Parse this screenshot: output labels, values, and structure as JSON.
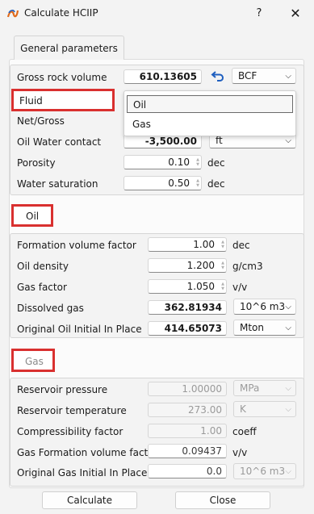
{
  "window": {
    "title": "Calculate HCIIP",
    "help": "?",
    "close": "✕"
  },
  "tab": {
    "label": "General parameters"
  },
  "general": {
    "gross_rock_volume": {
      "label": "Gross rock volume",
      "value": "610.13605",
      "unit": "BCF"
    },
    "fluid": {
      "label": "Fluid",
      "options": [
        "Oil",
        "Gas"
      ],
      "selected": "Oil"
    },
    "net_gross": {
      "label": "Net/Gross"
    },
    "owc": {
      "label": "Oil Water contact",
      "value": "-3,500.00",
      "unit": "ft"
    },
    "porosity": {
      "label": "Porosity",
      "value": "0.10",
      "unit": "dec"
    },
    "water_saturation": {
      "label": "Water saturation",
      "value": "0.50",
      "unit": "dec"
    }
  },
  "oil": {
    "header": "Oil",
    "fvf": {
      "label": "Formation volume factor",
      "value": "1.00",
      "unit": "dec"
    },
    "density": {
      "label": "Oil density",
      "value": "1.200",
      "unit": "g/cm3"
    },
    "gas_factor": {
      "label": "Gas factor",
      "value": "1.050",
      "unit": "v/v"
    },
    "dissolved_gas": {
      "label": "Dissolved gas",
      "value": "362.81934",
      "unit": "10^6 m3"
    },
    "ooip": {
      "label": "Original Oil Initial In Place",
      "value": "414.65073",
      "unit": "Mton"
    }
  },
  "gas": {
    "header": "Gas",
    "pressure": {
      "label": "Reservoir pressure",
      "value": "1.00000",
      "unit": "MPa"
    },
    "temperature": {
      "label": "Reservoir temperature",
      "value": "273.00",
      "unit": "K"
    },
    "z_factor": {
      "label": "Compressibility factor",
      "value": "1.00",
      "unit": "coeff"
    },
    "gas_fvf": {
      "label": "Gas Formation volume factor",
      "value": "0.09437",
      "unit": "v/v"
    },
    "ogip": {
      "label": "Original Gas Initial In Place",
      "value": "0.0",
      "unit": "10^6 m3"
    }
  },
  "buttons": {
    "calculate": "Calculate",
    "close": "Close"
  },
  "colors": {
    "highlight": "#d9302f",
    "reset_arrow": "#1f5fbf"
  },
  "icons": {
    "app": "app-logo-icon",
    "reset": "undo-arrow-icon",
    "dropdown": "chevron-down-icon"
  }
}
